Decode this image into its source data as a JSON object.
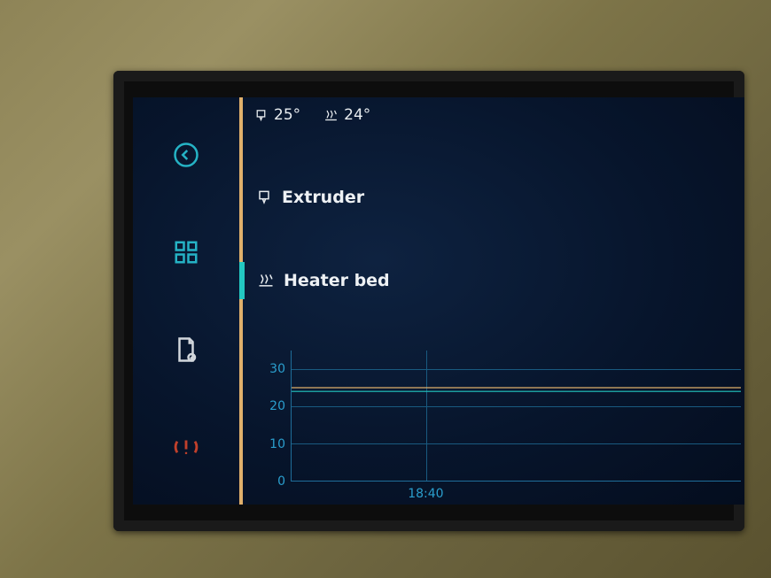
{
  "status": {
    "extruder_temp": "25°",
    "bed_temp": "24°"
  },
  "heaters": {
    "extruder_label": "Extruder",
    "bed_label": "Heater bed"
  },
  "nav": {
    "back": "back-icon",
    "grid": "grid-icon",
    "file": "file-icon",
    "estop": "emergency-stop-icon"
  },
  "colors": {
    "accent_orange": "#e0b06b",
    "accent_cyan": "#23c8c2",
    "grid_blue": "#1f6e9a"
  },
  "chart_data": {
    "type": "line",
    "title": "",
    "xlabel": "",
    "ylabel": "",
    "ylim": [
      0,
      35
    ],
    "yticks": [
      0,
      10,
      20,
      30
    ],
    "xticks": [
      "18:40"
    ],
    "series": [
      {
        "name": "Extruder",
        "color": "#e0b06b",
        "values": [
          25,
          25,
          25,
          25,
          25,
          25
        ]
      },
      {
        "name": "Heater bed",
        "color": "#23c8c2",
        "values": [
          24,
          24,
          24,
          24,
          24,
          24
        ]
      }
    ]
  }
}
